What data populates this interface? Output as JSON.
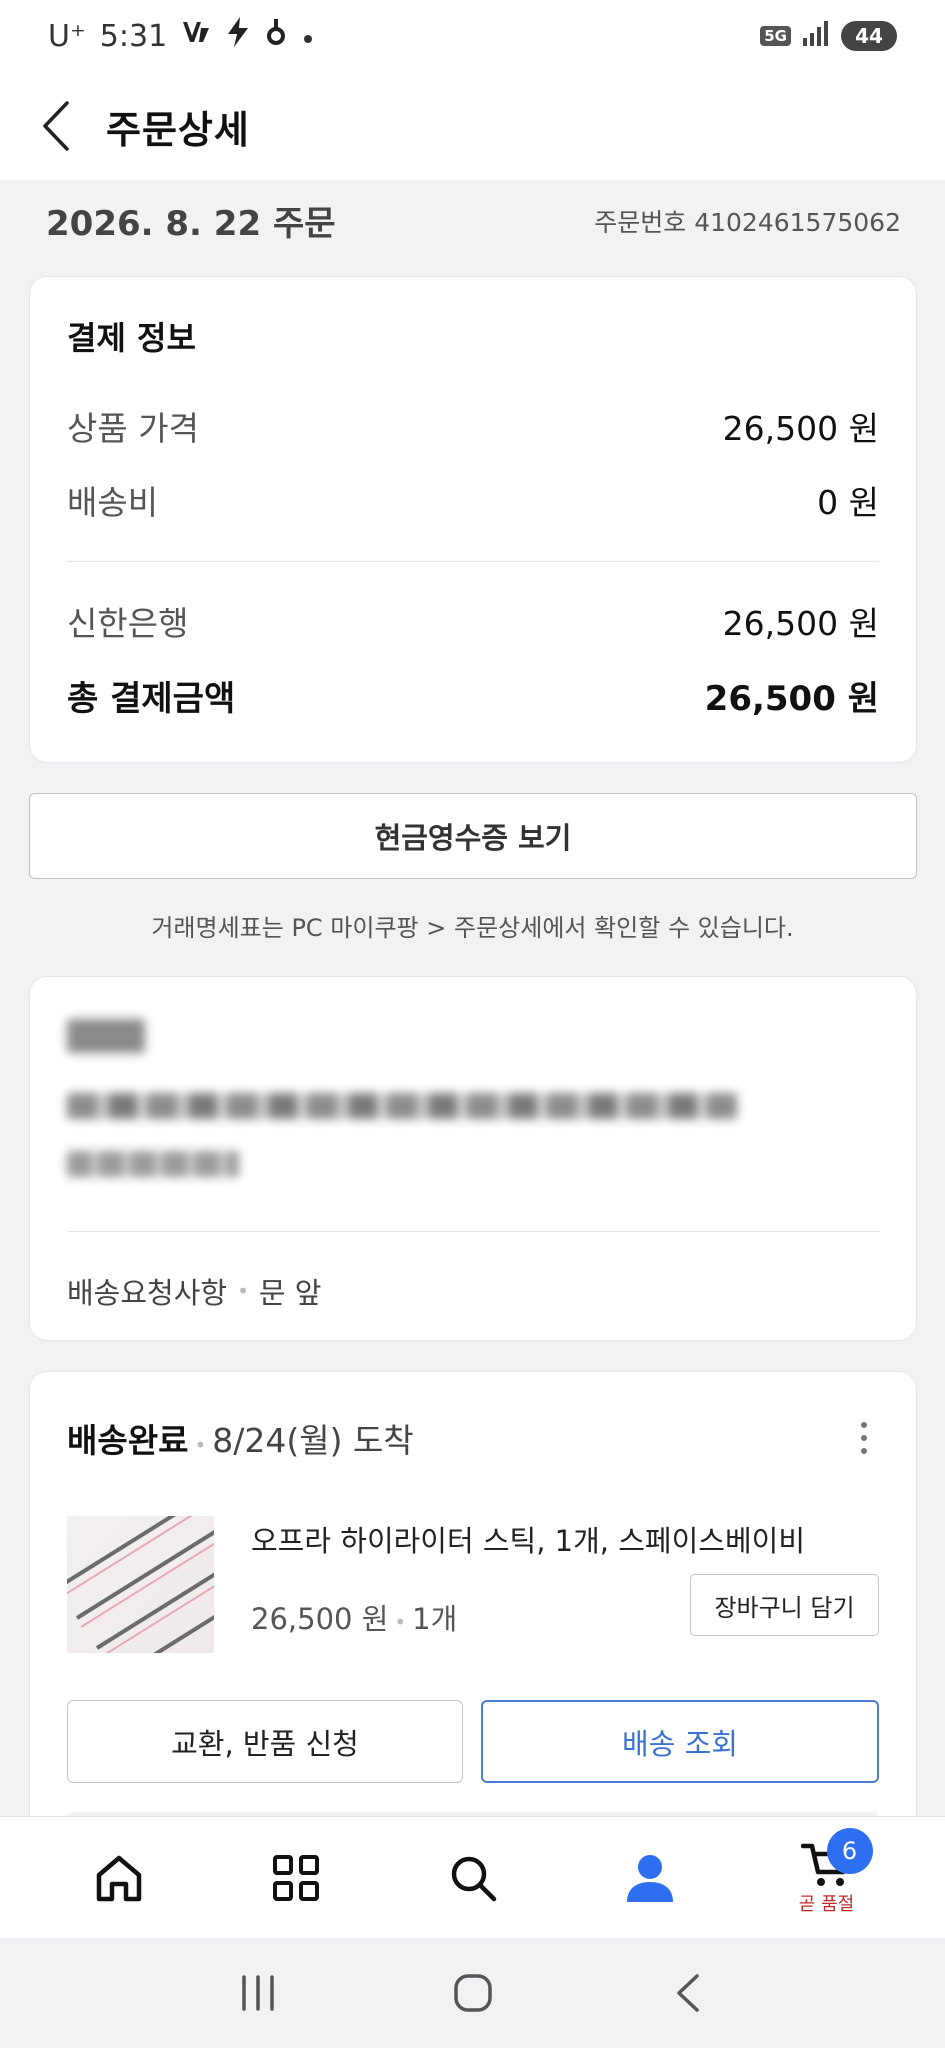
{
  "status_bar": {
    "carrier": "U⁺",
    "time": "5:31",
    "network": "5G",
    "battery": "44"
  },
  "header": {
    "title": "주문상세"
  },
  "order": {
    "date": "2026. 8. 22 주문",
    "number": "주문번호 4102461575062"
  },
  "payment": {
    "title": "결제 정보",
    "product_price_label": "상품 가격",
    "product_price_value": "26,500 원",
    "shipping_fee_label": "배송비",
    "shipping_fee_value": "0 원",
    "bank_label": "신한은행",
    "bank_value": "26,500 원",
    "total_label": "총 결제금액",
    "total_value": "26,500 원"
  },
  "receipt": {
    "button_label": "현금영수증 보기",
    "note": "거래명세표는 PC 마이쿠팡 > 주문상세에서 확인할 수 있습니다."
  },
  "address": {
    "request_label": "배송요청사항",
    "request_value": "문 앞"
  },
  "shipment": {
    "status": "배송완료",
    "arrival": "8/24(월) 도착",
    "product": {
      "name": "오프라 하이라이터 스틱, 1개, 스페이스베이비",
      "price": "26,500 원",
      "quantity": "1개"
    },
    "cart_button": "장바구니 담기",
    "return_button": "교환, 반품 신청",
    "track_button": "배송 조회"
  },
  "bottom_nav": {
    "cart_badge": "6",
    "cart_sub": "곧 품절"
  },
  "colors": {
    "accent": "#3b73d0",
    "badge": "#2e6ff2",
    "soldout": "#c02a2a"
  }
}
